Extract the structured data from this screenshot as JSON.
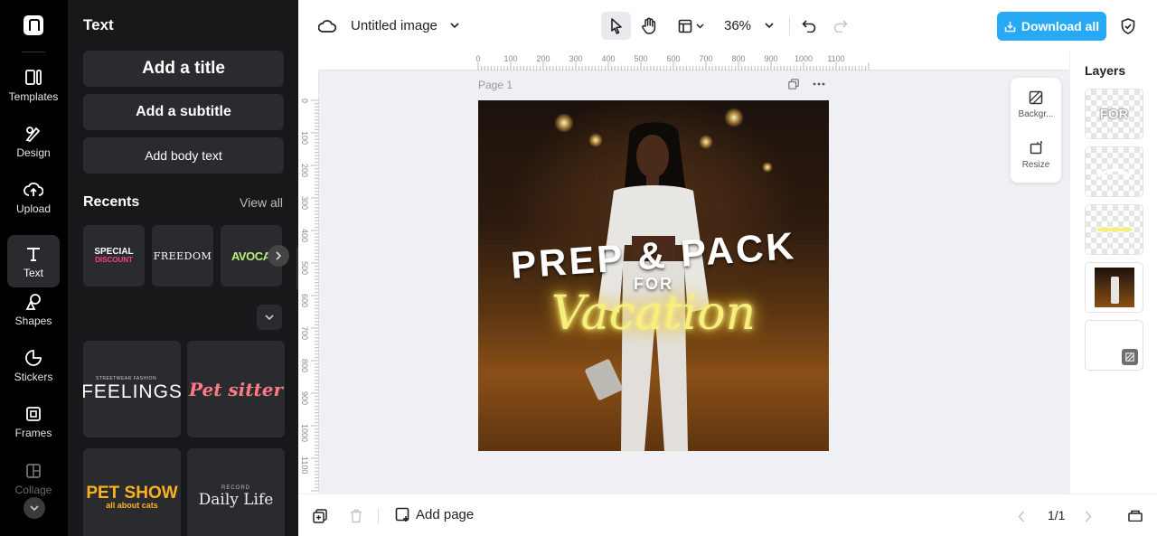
{
  "rail": {
    "items": [
      {
        "label": "Templates",
        "icon": "templates-icon"
      },
      {
        "label": "Design",
        "icon": "design-icon"
      },
      {
        "label": "Upload",
        "icon": "upload-icon"
      },
      {
        "label": "Text",
        "icon": "text-icon",
        "active": true
      },
      {
        "label": "Shapes",
        "icon": "shapes-icon"
      },
      {
        "label": "Stickers",
        "icon": "stickers-icon"
      },
      {
        "label": "Frames",
        "icon": "frames-icon"
      },
      {
        "label": "Collage",
        "icon": "collage-icon"
      }
    ]
  },
  "panel": {
    "title": "Text",
    "add_title": "Add a title",
    "add_subtitle": "Add a subtitle",
    "add_body": "Add body text",
    "recents_label": "Recents",
    "view_all": "View all",
    "recents": [
      {
        "line1": "SPECIAL",
        "line2": "DISCOUNT"
      },
      {
        "line1": "FREEDOM"
      },
      {
        "line1": "AVOCADO"
      }
    ],
    "templates": [
      {
        "small": "STREETWEAR FASHION",
        "main": "FEELINGS"
      },
      {
        "main": "Pet sitter"
      },
      {
        "main": "PET SHOW",
        "small": "all about cats"
      },
      {
        "small": "RECORD",
        "main": "Daily Life"
      }
    ]
  },
  "topbar": {
    "doc_title": "Untitled image",
    "zoom": "36%",
    "download_label": "Download all"
  },
  "canvas": {
    "page_label": "Page 1",
    "ruler_h": [
      "0",
      "100",
      "200",
      "300",
      "400",
      "500",
      "600",
      "700",
      "800",
      "900",
      "1000",
      "1100"
    ],
    "ruler_v": [
      "0",
      "100",
      "200",
      "300",
      "400",
      "500",
      "600",
      "700",
      "800",
      "900",
      "1000",
      "1100"
    ],
    "artwork": {
      "headline": "PREP & PACK",
      "connector": "FOR",
      "script": "Vacation"
    }
  },
  "float": {
    "background_label": "Backgr...",
    "resize_label": "Resize"
  },
  "layers": {
    "title": "Layers",
    "items": [
      {
        "name": "FOR"
      },
      {
        "name": "PREP & PACK"
      },
      {
        "name": "Vacation"
      },
      {
        "name": "photo"
      },
      {
        "name": "background"
      }
    ]
  },
  "bottom": {
    "add_page": "Add page",
    "page_count": "1/1"
  },
  "colors": {
    "accent": "#28a9f6",
    "neon": "#f6f07a",
    "rail_bg": "#000000",
    "panel_bg": "#17181a"
  }
}
